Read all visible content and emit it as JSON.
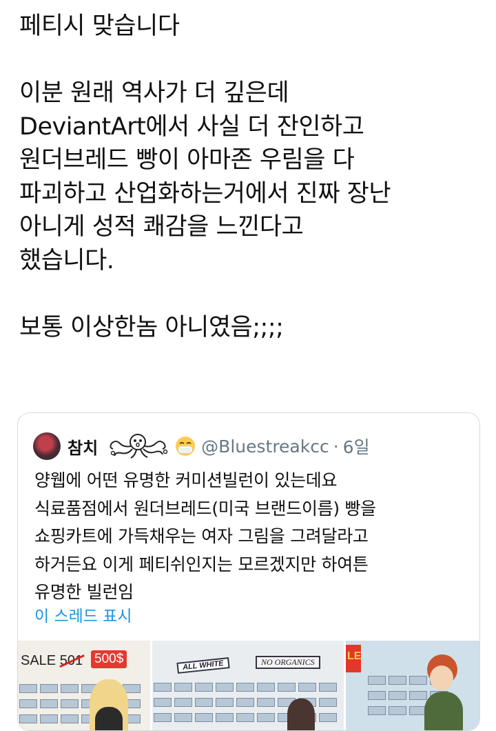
{
  "tweet": {
    "text": "페티시 맞습니다\n\n이분 원래 역사가 더 깊은데\nDeviantArt에서 사실 더 잔인하고\n원더브레드 빵이 아마존 우림을 다\n파괴하고 산업화하는거에서 진짜 장난\n아니게 성적 쾌감을 느낀다고\n했습니다.\n\n보통 이상한놈 아니였음;;;;"
  },
  "quote": {
    "display_name": "참치",
    "handle": "@Bluestreakcc",
    "separator": "·",
    "time": "6일",
    "body": "양웹에 어떤 유명한 커미션빌런이 있는데요\n식료품점에서 원더브레드(미국 브랜드이름) 빵을\n쇼핑카트에 가득채우는 여자 그림을 그려달라고\n하거든요 이게 페티쉬인지는 모르겠지만 하여튼\n유명한 빌런임",
    "show_thread": "이 스레드 표시",
    "icons": [
      "avatar",
      "octopus-doodle-icon",
      "mask-face-emoji-icon"
    ]
  },
  "media": {
    "panel1": {
      "sale_label": "SALE",
      "old_price": "501",
      "new_price": "500$"
    },
    "panel2": {
      "sign_left": "ALL WHITE",
      "sign_right": "NO ORGANICS"
    },
    "panel3": {
      "sign": "LE"
    }
  },
  "colors": {
    "link": "#1b95e0",
    "muted": "#657786",
    "border": "#d3dbe1",
    "price_tag": "#e53930"
  }
}
